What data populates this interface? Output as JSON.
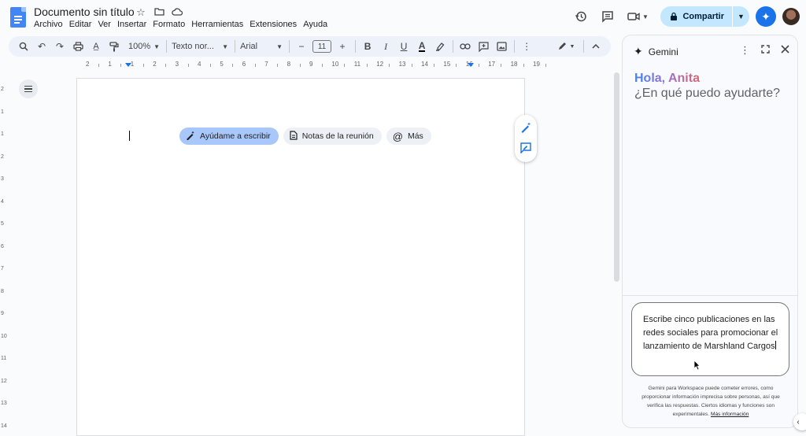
{
  "header": {
    "title": "Documento sin título",
    "menu": [
      "Archivo",
      "Editar",
      "Ver",
      "Insertar",
      "Formato",
      "Herramientas",
      "Extensiones",
      "Ayuda"
    ],
    "share_label": "Compartir"
  },
  "toolbar": {
    "zoom": "100%",
    "style": "Texto nor...",
    "font": "Arial",
    "font_size": "11"
  },
  "ruler": {
    "labels": [
      "2",
      "1",
      "1",
      "2",
      "3",
      "4",
      "5",
      "6",
      "7",
      "8",
      "9",
      "10",
      "11",
      "12",
      "13",
      "14",
      "15",
      "16",
      "17",
      "18",
      "19"
    ]
  },
  "vruler": {
    "labels": [
      "2",
      "1",
      "1",
      "2",
      "3",
      "4",
      "5",
      "6",
      "7",
      "8",
      "9",
      "10",
      "11",
      "12",
      "13",
      "14"
    ]
  },
  "document": {
    "chips": [
      {
        "label": "Ayúdame a escribir",
        "icon": "pen-sparkle-icon"
      },
      {
        "label": "Notas de la reunión",
        "icon": "document-icon"
      },
      {
        "label": "Más",
        "icon": "at-icon"
      }
    ]
  },
  "gemini": {
    "title": "Gemini",
    "greeting": "Hola, Anita",
    "question": "¿En qué puedo ayudarte?",
    "prompt": "Escribe cinco publicaciones en las redes sociales para promocionar el lanzamiento de Marshland Cargos",
    "disclaimer": "Gemini para Workspace puede cometer errores, como proporcionar información imprecisa sobre personas, así que verifica las respuestas. Ciertos idiomas y funciones son experimentales.",
    "more_info": "Más información"
  },
  "colors": {
    "accent": "#1a73e8",
    "share_bg": "#c2e7ff",
    "chip_primary": "#a8c7fa",
    "toolbar_bg": "#edf2fa"
  }
}
